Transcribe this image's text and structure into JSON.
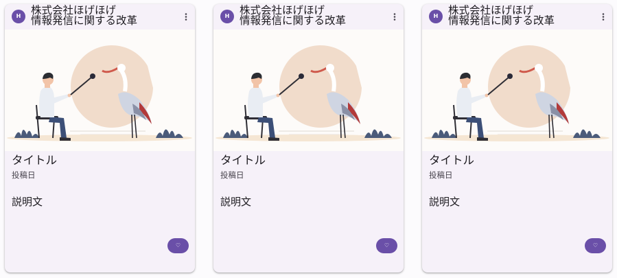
{
  "cards": [
    {
      "avatar_letter": "H",
      "header_title": "株式会社ほげほげ\n情報発信に関する改革",
      "more_icon": "more-vert-icon",
      "image_alt": "illustration-person-with-stork",
      "title": "タイトル",
      "subhead": "投稿日",
      "description": "説明文",
      "like_icon": "heart-icon",
      "like_glyph": "♡"
    },
    {
      "avatar_letter": "H",
      "header_title": "株式会社ほげほげ\n情報発信に関する改革",
      "more_icon": "more-vert-icon",
      "image_alt": "illustration-person-with-stork",
      "title": "タイトル",
      "subhead": "投稿日",
      "description": "説明文",
      "like_icon": "heart-icon",
      "like_glyph": "♡"
    },
    {
      "avatar_letter": "H",
      "header_title": "株式会社ほげほげ\n情報発信に関する改革",
      "more_icon": "more-vert-icon",
      "image_alt": "illustration-person-with-stork",
      "title": "タイトル",
      "subhead": "投稿日",
      "description": "説明文",
      "like_icon": "heart-icon",
      "like_glyph": "♡"
    }
  ],
  "colors": {
    "accent": "#6a4fa8",
    "card_background": "#f6f1f9",
    "text_primary": "#1d1b20",
    "text_secondary": "#49454f"
  }
}
